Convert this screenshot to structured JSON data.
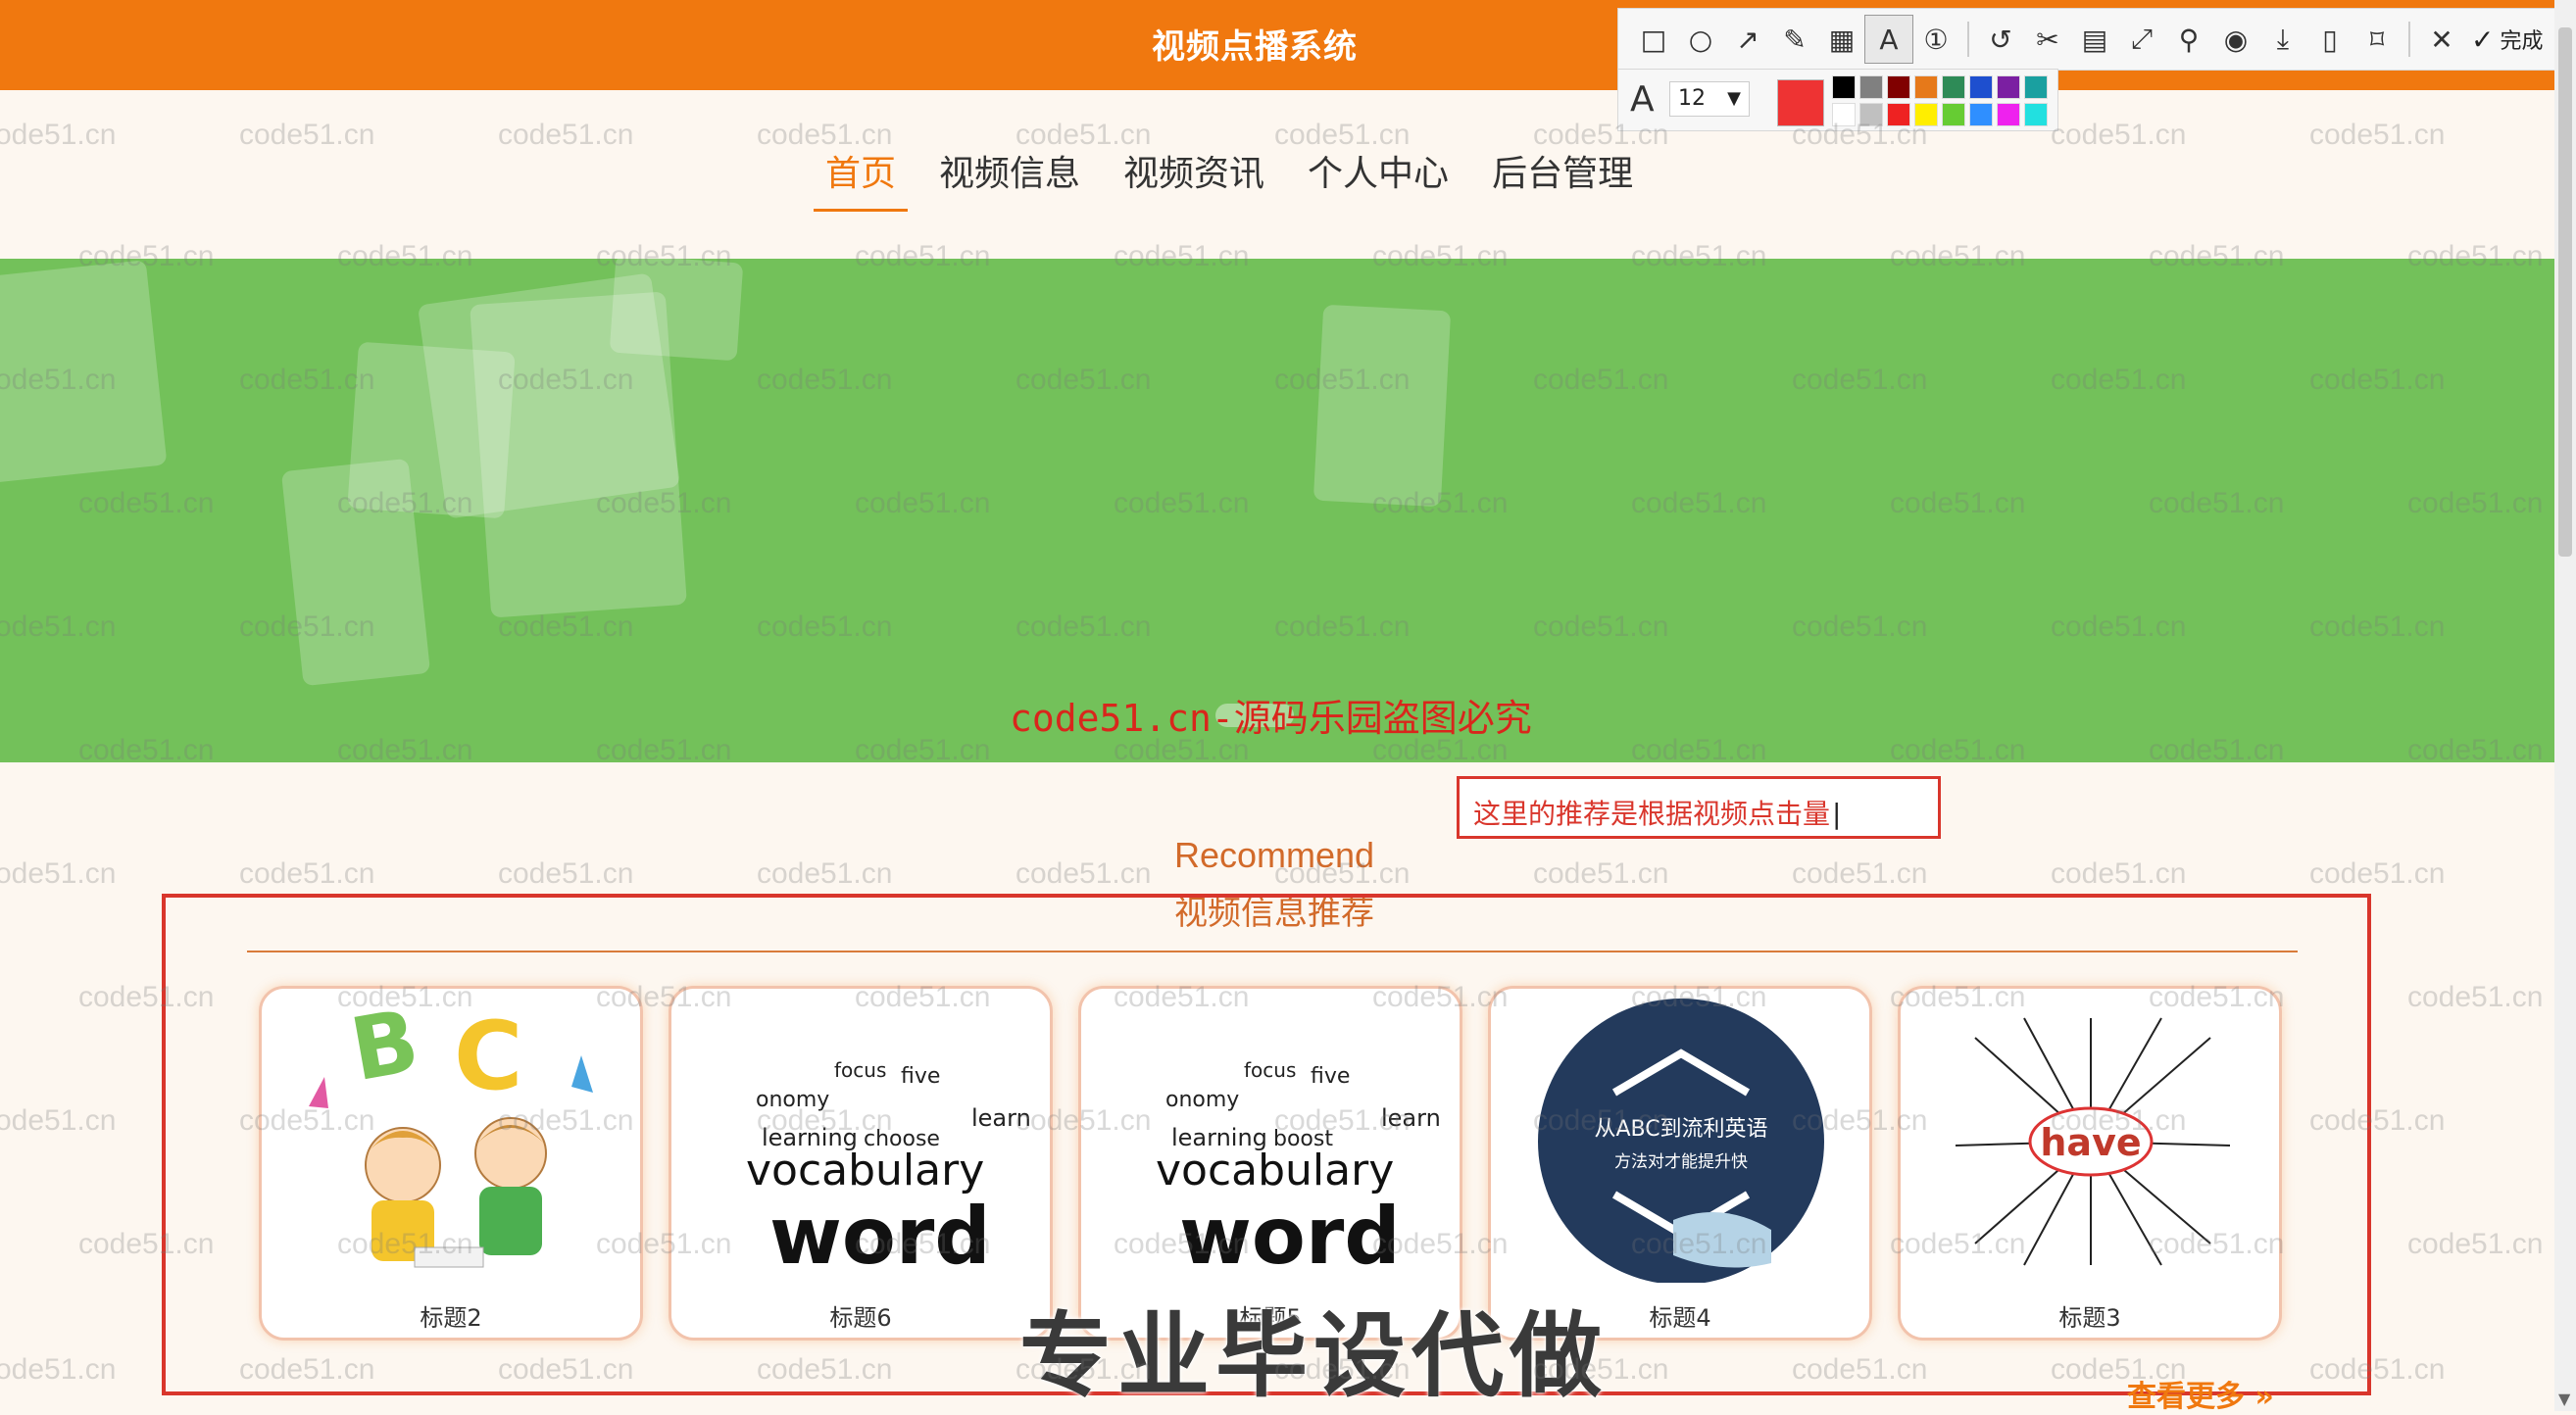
{
  "site_title": "视频点播系统",
  "nav": {
    "items": [
      {
        "label": "首页",
        "active": true
      },
      {
        "label": "视频信息",
        "active": false
      },
      {
        "label": "视频资讯",
        "active": false
      },
      {
        "label": "个人中心",
        "active": false
      },
      {
        "label": "后台管理",
        "active": false
      }
    ]
  },
  "banner": {
    "watermark_text": "code51.cn-源码乐园盗图必究"
  },
  "annotation": {
    "text": "这里的推荐是根据视频点击量"
  },
  "recommend": {
    "title_en": "Recommend",
    "title_cn": "视频信息推荐",
    "cards": [
      {
        "caption": "标题2",
        "image": "abc-kids-illustration"
      },
      {
        "caption": "标题6",
        "image": "vocabulary-word-cloud"
      },
      {
        "caption": "标题5",
        "image": "vocabulary-word-cloud"
      },
      {
        "caption": "标题4",
        "image": "english-course-circle"
      },
      {
        "caption": "标题3",
        "image": "have-mindmap"
      }
    ],
    "more_link": "查看更多"
  },
  "english_badge": {
    "line1": "从ABC到流利英语",
    "line2": "方法对才能提升快"
  },
  "mindmap_word": "have",
  "word_cloud": {
    "main": "vocabulary",
    "big": "word",
    "others": [
      "learning",
      "focus",
      "five",
      "onomy",
      "learn",
      "choose",
      "boost"
    ]
  },
  "screenshot_toolbar": {
    "tools": [
      "rect-icon",
      "ellipse-icon",
      "arrow-icon",
      "pen-icon",
      "mosaic-icon",
      "text-icon",
      "number-icon",
      "undo-icon",
      "cut-icon",
      "ocr-icon",
      "fit-icon",
      "pin-icon",
      "record-icon",
      "download-icon",
      "save-icon",
      "bookmark-icon",
      "close-icon"
    ],
    "done_label": "完成",
    "font_size": "12",
    "current_color": "#ee3333",
    "palette": [
      "#000000",
      "#808080",
      "#800000",
      "#e6791a",
      "#2e8b57",
      "#1e4fcf",
      "#7b1fa2",
      "#1aa0a0",
      "#ffffff",
      "#c0c0c0",
      "#ee2222",
      "#ffee00",
      "#66cc33",
      "#2f8fff",
      "#ee22ee",
      "#22e0e0"
    ]
  },
  "overlay_promo": "专业毕设代做",
  "watermark_tile": "code51.cn",
  "colors": {
    "brand_orange": "#f0780f",
    "banner_green": "#73c15a",
    "accent_red": "#d9362c"
  }
}
